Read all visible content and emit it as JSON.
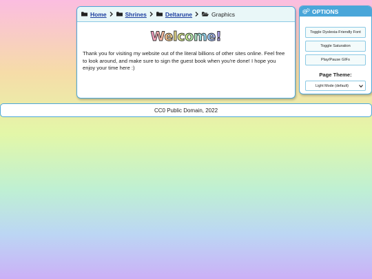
{
  "breadcrumb": {
    "items": [
      {
        "label": "Home",
        "icon": "folder-icon"
      },
      {
        "label": "Shrines",
        "icon": "folder-icon"
      },
      {
        "label": "Deltarune",
        "icon": "folder-icon"
      },
      {
        "label": "Graphics",
        "icon": "folder-open-icon"
      }
    ]
  },
  "main": {
    "welcome_title": "Welcome!",
    "intro": "Thank you for visiting my website out of the literal billions of other sites online. Feel free to look around, and make sure to sign the guest book when you're done! I hope you enjoy your time here :)"
  },
  "options": {
    "title": "OPTIONS",
    "icon": "gears-icon",
    "buttons": [
      "Toggle Dyslexia-Friendly Font",
      "Toggle Saturation",
      "Play/Pause GIFs"
    ],
    "theme_label": "Page Theme:",
    "theme_selected": "Light Mode (default)"
  },
  "footer": {
    "text": "CC0 Public Domain, 2022"
  },
  "colors": {
    "accent": "#4aa6d9",
    "link": "#1a3c9e",
    "crumb_bg": "#e9f7f8"
  }
}
